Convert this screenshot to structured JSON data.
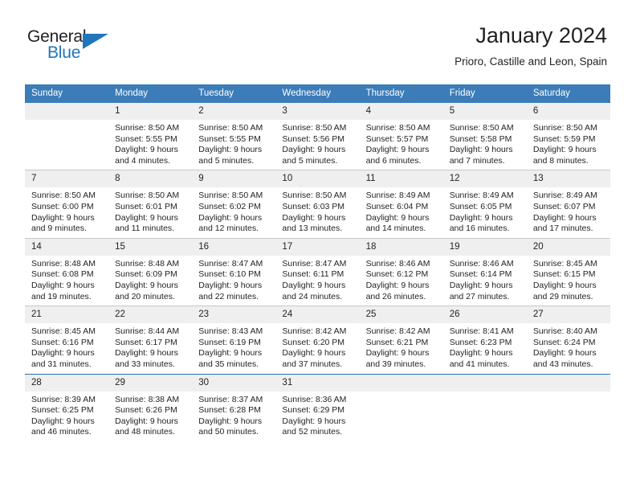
{
  "brand": {
    "name_top": "General",
    "name_bottom": "Blue",
    "color_primary": "#1f76bc",
    "color_text": "#231f20"
  },
  "header": {
    "title": "January 2024",
    "subtitle": "Prioro, Castille and Leon, Spain"
  },
  "calendar": {
    "header_bg": "#3c7cb8",
    "daynum_bg": "#efefef",
    "weekday_headers": [
      "Sunday",
      "Monday",
      "Tuesday",
      "Wednesday",
      "Thursday",
      "Friday",
      "Saturday"
    ],
    "weeks": [
      [
        {
          "day": "",
          "blank": true,
          "sunrise": "",
          "sunset": "",
          "daylight_line1": "",
          "daylight_line2": ""
        },
        {
          "day": "1",
          "sunrise": "Sunrise: 8:50 AM",
          "sunset": "Sunset: 5:55 PM",
          "daylight_line1": "Daylight: 9 hours",
          "daylight_line2": "and 4 minutes."
        },
        {
          "day": "2",
          "sunrise": "Sunrise: 8:50 AM",
          "sunset": "Sunset: 5:55 PM",
          "daylight_line1": "Daylight: 9 hours",
          "daylight_line2": "and 5 minutes."
        },
        {
          "day": "3",
          "sunrise": "Sunrise: 8:50 AM",
          "sunset": "Sunset: 5:56 PM",
          "daylight_line1": "Daylight: 9 hours",
          "daylight_line2": "and 5 minutes."
        },
        {
          "day": "4",
          "sunrise": "Sunrise: 8:50 AM",
          "sunset": "Sunset: 5:57 PM",
          "daylight_line1": "Daylight: 9 hours",
          "daylight_line2": "and 6 minutes."
        },
        {
          "day": "5",
          "sunrise": "Sunrise: 8:50 AM",
          "sunset": "Sunset: 5:58 PM",
          "daylight_line1": "Daylight: 9 hours",
          "daylight_line2": "and 7 minutes."
        },
        {
          "day": "6",
          "sunrise": "Sunrise: 8:50 AM",
          "sunset": "Sunset: 5:59 PM",
          "daylight_line1": "Daylight: 9 hours",
          "daylight_line2": "and 8 minutes."
        }
      ],
      [
        {
          "day": "7",
          "sunrise": "Sunrise: 8:50 AM",
          "sunset": "Sunset: 6:00 PM",
          "daylight_line1": "Daylight: 9 hours",
          "daylight_line2": "and 9 minutes."
        },
        {
          "day": "8",
          "sunrise": "Sunrise: 8:50 AM",
          "sunset": "Sunset: 6:01 PM",
          "daylight_line1": "Daylight: 9 hours",
          "daylight_line2": "and 11 minutes."
        },
        {
          "day": "9",
          "sunrise": "Sunrise: 8:50 AM",
          "sunset": "Sunset: 6:02 PM",
          "daylight_line1": "Daylight: 9 hours",
          "daylight_line2": "and 12 minutes."
        },
        {
          "day": "10",
          "sunrise": "Sunrise: 8:50 AM",
          "sunset": "Sunset: 6:03 PM",
          "daylight_line1": "Daylight: 9 hours",
          "daylight_line2": "and 13 minutes."
        },
        {
          "day": "11",
          "sunrise": "Sunrise: 8:49 AM",
          "sunset": "Sunset: 6:04 PM",
          "daylight_line1": "Daylight: 9 hours",
          "daylight_line2": "and 14 minutes."
        },
        {
          "day": "12",
          "sunrise": "Sunrise: 8:49 AM",
          "sunset": "Sunset: 6:05 PM",
          "daylight_line1": "Daylight: 9 hours",
          "daylight_line2": "and 16 minutes."
        },
        {
          "day": "13",
          "sunrise": "Sunrise: 8:49 AM",
          "sunset": "Sunset: 6:07 PM",
          "daylight_line1": "Daylight: 9 hours",
          "daylight_line2": "and 17 minutes."
        }
      ],
      [
        {
          "day": "14",
          "sunrise": "Sunrise: 8:48 AM",
          "sunset": "Sunset: 6:08 PM",
          "daylight_line1": "Daylight: 9 hours",
          "daylight_line2": "and 19 minutes."
        },
        {
          "day": "15",
          "sunrise": "Sunrise: 8:48 AM",
          "sunset": "Sunset: 6:09 PM",
          "daylight_line1": "Daylight: 9 hours",
          "daylight_line2": "and 20 minutes."
        },
        {
          "day": "16",
          "sunrise": "Sunrise: 8:47 AM",
          "sunset": "Sunset: 6:10 PM",
          "daylight_line1": "Daylight: 9 hours",
          "daylight_line2": "and 22 minutes."
        },
        {
          "day": "17",
          "sunrise": "Sunrise: 8:47 AM",
          "sunset": "Sunset: 6:11 PM",
          "daylight_line1": "Daylight: 9 hours",
          "daylight_line2": "and 24 minutes."
        },
        {
          "day": "18",
          "sunrise": "Sunrise: 8:46 AM",
          "sunset": "Sunset: 6:12 PM",
          "daylight_line1": "Daylight: 9 hours",
          "daylight_line2": "and 26 minutes."
        },
        {
          "day": "19",
          "sunrise": "Sunrise: 8:46 AM",
          "sunset": "Sunset: 6:14 PM",
          "daylight_line1": "Daylight: 9 hours",
          "daylight_line2": "and 27 minutes."
        },
        {
          "day": "20",
          "sunrise": "Sunrise: 8:45 AM",
          "sunset": "Sunset: 6:15 PM",
          "daylight_line1": "Daylight: 9 hours",
          "daylight_line2": "and 29 minutes."
        }
      ],
      [
        {
          "day": "21",
          "sunrise": "Sunrise: 8:45 AM",
          "sunset": "Sunset: 6:16 PM",
          "daylight_line1": "Daylight: 9 hours",
          "daylight_line2": "and 31 minutes."
        },
        {
          "day": "22",
          "sunrise": "Sunrise: 8:44 AM",
          "sunset": "Sunset: 6:17 PM",
          "daylight_line1": "Daylight: 9 hours",
          "daylight_line2": "and 33 minutes."
        },
        {
          "day": "23",
          "sunrise": "Sunrise: 8:43 AM",
          "sunset": "Sunset: 6:19 PM",
          "daylight_line1": "Daylight: 9 hours",
          "daylight_line2": "and 35 minutes."
        },
        {
          "day": "24",
          "sunrise": "Sunrise: 8:42 AM",
          "sunset": "Sunset: 6:20 PM",
          "daylight_line1": "Daylight: 9 hours",
          "daylight_line2": "and 37 minutes."
        },
        {
          "day": "25",
          "sunrise": "Sunrise: 8:42 AM",
          "sunset": "Sunset: 6:21 PM",
          "daylight_line1": "Daylight: 9 hours",
          "daylight_line2": "and 39 minutes."
        },
        {
          "day": "26",
          "sunrise": "Sunrise: 8:41 AM",
          "sunset": "Sunset: 6:23 PM",
          "daylight_line1": "Daylight: 9 hours",
          "daylight_line2": "and 41 minutes."
        },
        {
          "day": "27",
          "sunrise": "Sunrise: 8:40 AM",
          "sunset": "Sunset: 6:24 PM",
          "daylight_line1": "Daylight: 9 hours",
          "daylight_line2": "and 43 minutes."
        }
      ],
      [
        {
          "day": "28",
          "sunrise": "Sunrise: 8:39 AM",
          "sunset": "Sunset: 6:25 PM",
          "daylight_line1": "Daylight: 9 hours",
          "daylight_line2": "and 46 minutes."
        },
        {
          "day": "29",
          "sunrise": "Sunrise: 8:38 AM",
          "sunset": "Sunset: 6:26 PM",
          "daylight_line1": "Daylight: 9 hours",
          "daylight_line2": "and 48 minutes."
        },
        {
          "day": "30",
          "sunrise": "Sunrise: 8:37 AM",
          "sunset": "Sunset: 6:28 PM",
          "daylight_line1": "Daylight: 9 hours",
          "daylight_line2": "and 50 minutes."
        },
        {
          "day": "31",
          "sunrise": "Sunrise: 8:36 AM",
          "sunset": "Sunset: 6:29 PM",
          "daylight_line1": "Daylight: 9 hours",
          "daylight_line2": "and 52 minutes."
        },
        {
          "day": "",
          "blank": true,
          "sunrise": "",
          "sunset": "",
          "daylight_line1": "",
          "daylight_line2": ""
        },
        {
          "day": "",
          "blank": true,
          "sunrise": "",
          "sunset": "",
          "daylight_line1": "",
          "daylight_line2": ""
        },
        {
          "day": "",
          "blank": true,
          "sunrise": "",
          "sunset": "",
          "daylight_line1": "",
          "daylight_line2": ""
        }
      ]
    ]
  }
}
